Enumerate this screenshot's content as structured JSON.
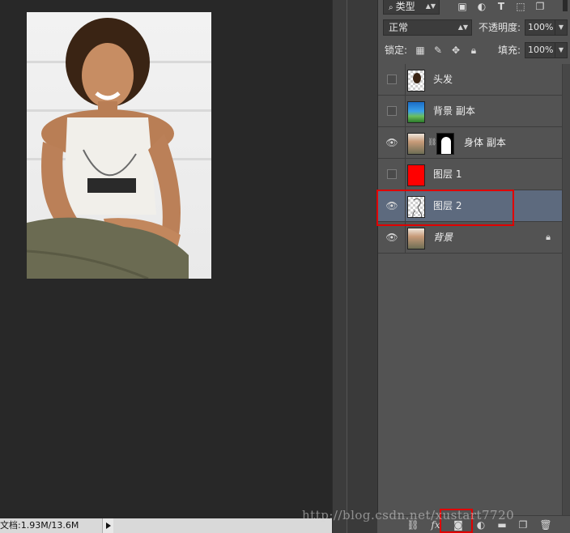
{
  "status": {
    "doc_info": "文档:1.93M/13.6M"
  },
  "panel": {
    "filter_kind": "类型",
    "blend_mode": "正常",
    "opacity_label": "不透明度:",
    "opacity_value": "100%",
    "lock_label": "锁定:",
    "fill_label": "填充:",
    "fill_value": "100%"
  },
  "layers": [
    {
      "name": "头发",
      "visible": false,
      "thumb": "transparent-hair"
    },
    {
      "name": "背景 副本",
      "visible": false,
      "thumb": "sky-photo"
    },
    {
      "name": "身体 副本",
      "visible": true,
      "thumb": "person-photo",
      "has_mask": true
    },
    {
      "name": "图层 1",
      "visible": false,
      "thumb": "red-fill"
    },
    {
      "name": "图层 2",
      "visible": true,
      "thumb": "transparent-sketch",
      "selected": true
    },
    {
      "name": "背景",
      "visible": true,
      "thumb": "person-photo",
      "locked": true
    }
  ],
  "icons": {
    "filter": "search-icon",
    "pixel_filter": "image-icon",
    "adjust_filter": "circle-half-icon",
    "type_filter": "text-T-icon",
    "shape_filter": "shape-icon",
    "smart_filter": "smart-object-icon",
    "lock_transparent": "checker-icon",
    "lock_paint": "brush-icon",
    "lock_move": "move-icon",
    "lock_all": "lock-icon",
    "link": "link-icon",
    "fx": "fx-icon",
    "add_mask": "mask-icon",
    "adjustment": "adjustment-icon",
    "group": "folder-icon",
    "new_layer": "new-layer-icon",
    "delete": "trash-icon"
  },
  "watermark": "http://blog.csdn.net/xustart7720",
  "colors": {
    "highlight": "#e00000",
    "selected_row": "#5d6a7e",
    "panel_bg": "#535353",
    "canvas_bg": "#282828"
  }
}
